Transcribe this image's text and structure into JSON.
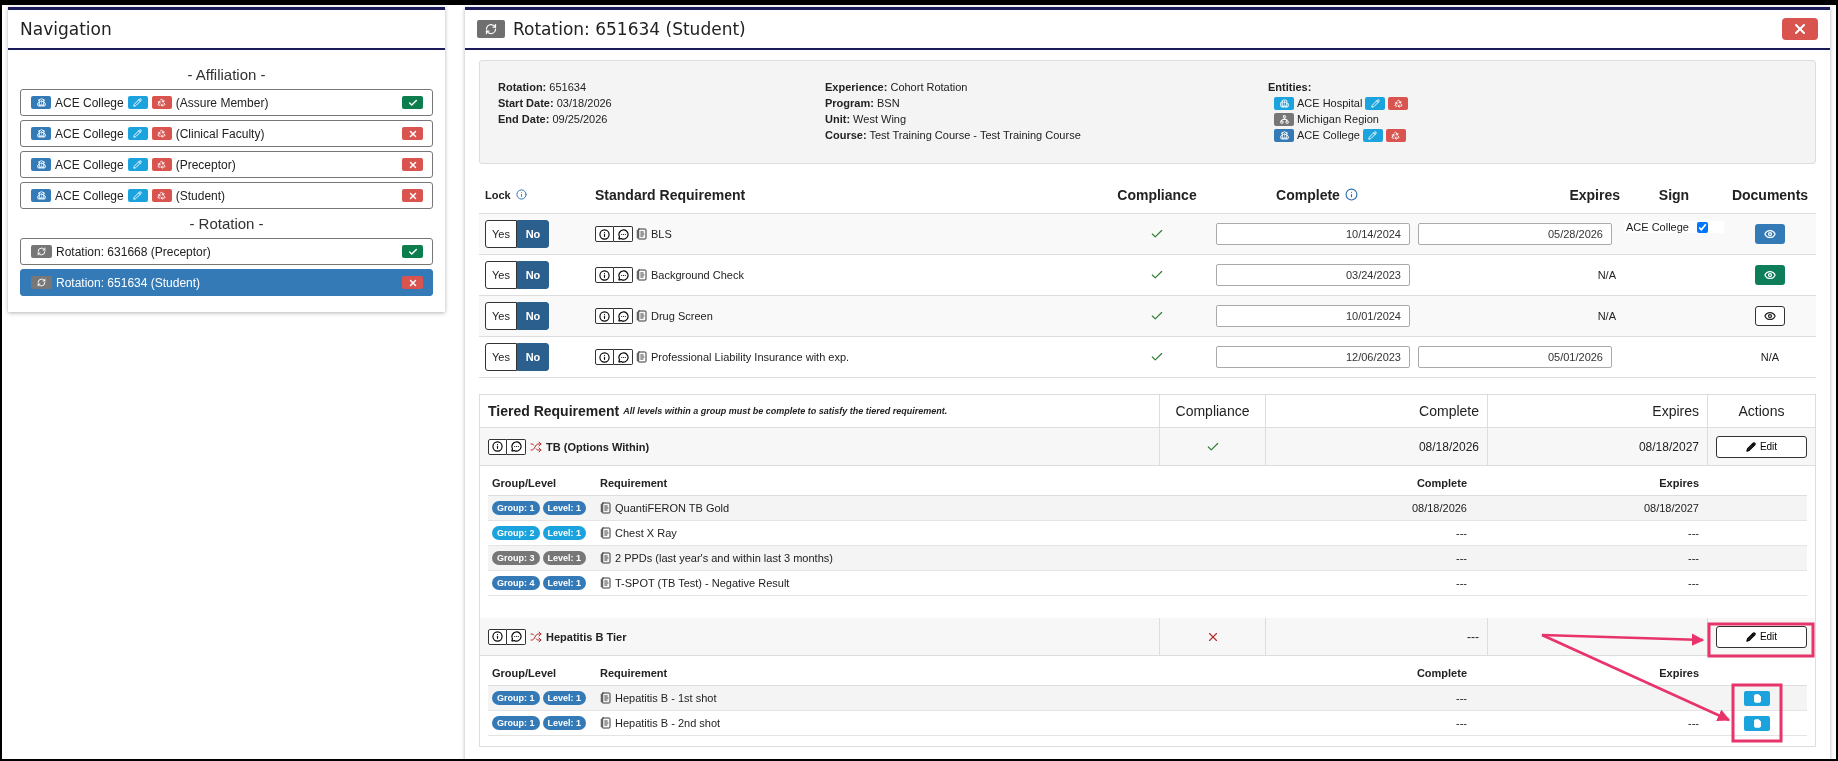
{
  "navigation": {
    "title": "Navigation",
    "affiliation_label": "- Affiliation -",
    "affiliations": [
      {
        "name": "ACE College",
        "role": "(Assure Member)",
        "compliant": true
      },
      {
        "name": "ACE College",
        "role": "(Clinical Faculty)",
        "compliant": false
      },
      {
        "name": "ACE College",
        "role": "(Preceptor)",
        "compliant": false
      },
      {
        "name": "ACE College",
        "role": "(Student)",
        "compliant": false
      }
    ],
    "rotation_label": "- Rotation -",
    "rotations": [
      {
        "label": "Rotation: 631668 (Preceptor)",
        "compliant": true,
        "selected": false
      },
      {
        "label": "Rotation: 651634 (Student)",
        "compliant": false,
        "selected": true
      }
    ]
  },
  "rotation": {
    "title": "Rotation: 651634 (Student)",
    "info": {
      "column_1": [
        "**Rotation:** 651634",
        "**Start Date:** 03/18/2026",
        "**End Date:** 09/25/2026"
      ],
      "column_2": [
        "**Experience:** Cohort Rotation",
        "**Program:** BSN",
        "**Unit:** West Wing",
        "**Course:** Test Training Course - Test Training Course"
      ],
      "entities_label": "Entities:",
      "entities": [
        {
          "kind": "hospital",
          "name": "ACE Hospital",
          "editable": true
        },
        {
          "kind": "region",
          "name": "Michigan Region",
          "editable": false
        },
        {
          "kind": "college",
          "name": "ACE College",
          "editable": true
        }
      ]
    },
    "standard": {
      "columns": [
        "Lock",
        "Standard Requirement",
        "Compliance",
        "Complete",
        "Expires",
        "Sign",
        "Documents"
      ],
      "rows": [
        {
          "lock": [
            {
              "label": "Yes",
              "selected": false
            },
            {
              "label": "No",
              "selected": true
            }
          ],
          "name": "BLS",
          "compliant": true,
          "complete": "10/14/2024",
          "expires": {
            "kind": "field",
            "value": "05/28/2026"
          },
          "sign": {
            "label": "ACE College",
            "checked": true
          },
          "documents": {
            "kind": "primary"
          }
        },
        {
          "lock": [
            {
              "label": "Yes",
              "selected": false
            },
            {
              "label": "No",
              "selected": true
            }
          ],
          "name": "Background Check",
          "compliant": true,
          "complete": "03/24/2023",
          "expires": {
            "kind": "text",
            "value": "N/A"
          },
          "documents": {
            "kind": "success"
          }
        },
        {
          "lock": [
            {
              "label": "Yes",
              "selected": false
            },
            {
              "label": "No",
              "selected": true
            }
          ],
          "name": "Drug Screen",
          "compliant": true,
          "complete": "10/01/2024",
          "expires": {
            "kind": "text",
            "value": "N/A"
          },
          "documents": {
            "kind": "outline"
          }
        },
        {
          "lock": [
            {
              "label": "Yes",
              "selected": false
            },
            {
              "label": "No",
              "selected": true
            }
          ],
          "name": "Professional Liability Insurance with exp.",
          "compliant": true,
          "complete": "12/06/2023",
          "expires": {
            "kind": "field",
            "value": "05/01/2026"
          },
          "documents": {
            "kind": "text",
            "value": "N/A"
          }
        }
      ]
    },
    "tiered": {
      "title": "Tiered Requirement",
      "note": "All levels within a group must be complete to satisfy the tiered requirement.",
      "columns": [
        "Compliance",
        "Complete",
        "Expires",
        "Actions"
      ],
      "groups": [
        {
          "name": "TB (Options Within)",
          "compliant": true,
          "complete": "08/18/2026",
          "expires": "08/18/2027",
          "action": "Edit",
          "sub_columns": [
            "Group/Level",
            "Requirement",
            "Complete",
            "Expires"
          ],
          "items": [
            {
              "group": "Group: 1",
              "level": "Level: 1",
              "color": "#337ab7",
              "requirement": "QuantiFERON TB Gold",
              "complete": "08/18/2026",
              "expires": "08/18/2027",
              "document": false
            },
            {
              "group": "Group: 2",
              "level": "Level: 1",
              "color": "#1aa3dd",
              "requirement": "Chest X Ray",
              "complete": "---",
              "expires": "---",
              "document": false
            },
            {
              "group": "Group: 3",
              "level": "Level: 1",
              "color": "#777777",
              "requirement": "2 PPDs (last year's and within last 3 months)",
              "complete": "---",
              "expires": "---",
              "document": false
            },
            {
              "group": "Group: 4",
              "level": "Level: 1",
              "color": "#337ab7",
              "requirement": "T-SPOT (TB Test) - Negative Result",
              "complete": "---",
              "expires": "---",
              "document": false
            }
          ]
        },
        {
          "name": "Hepatitis B Tier",
          "compliant": false,
          "complete": "---",
          "action": "Edit",
          "sub_columns": [
            "Group/Level",
            "Requirement",
            "Complete",
            "Expires"
          ],
          "items": [
            {
              "group": "Group: 1",
              "level": "Level: 1",
              "color": "#337ab7",
              "requirement": "Hepatitis B - 1st shot",
              "complete": "---",
              "document": true
            },
            {
              "group": "Group: 1",
              "level": "Level: 1",
              "color": "#337ab7",
              "requirement": "Hepatitis B - 2nd shot",
              "complete": "---",
              "expires": "---",
              "document": true
            }
          ]
        }
      ]
    }
  }
}
